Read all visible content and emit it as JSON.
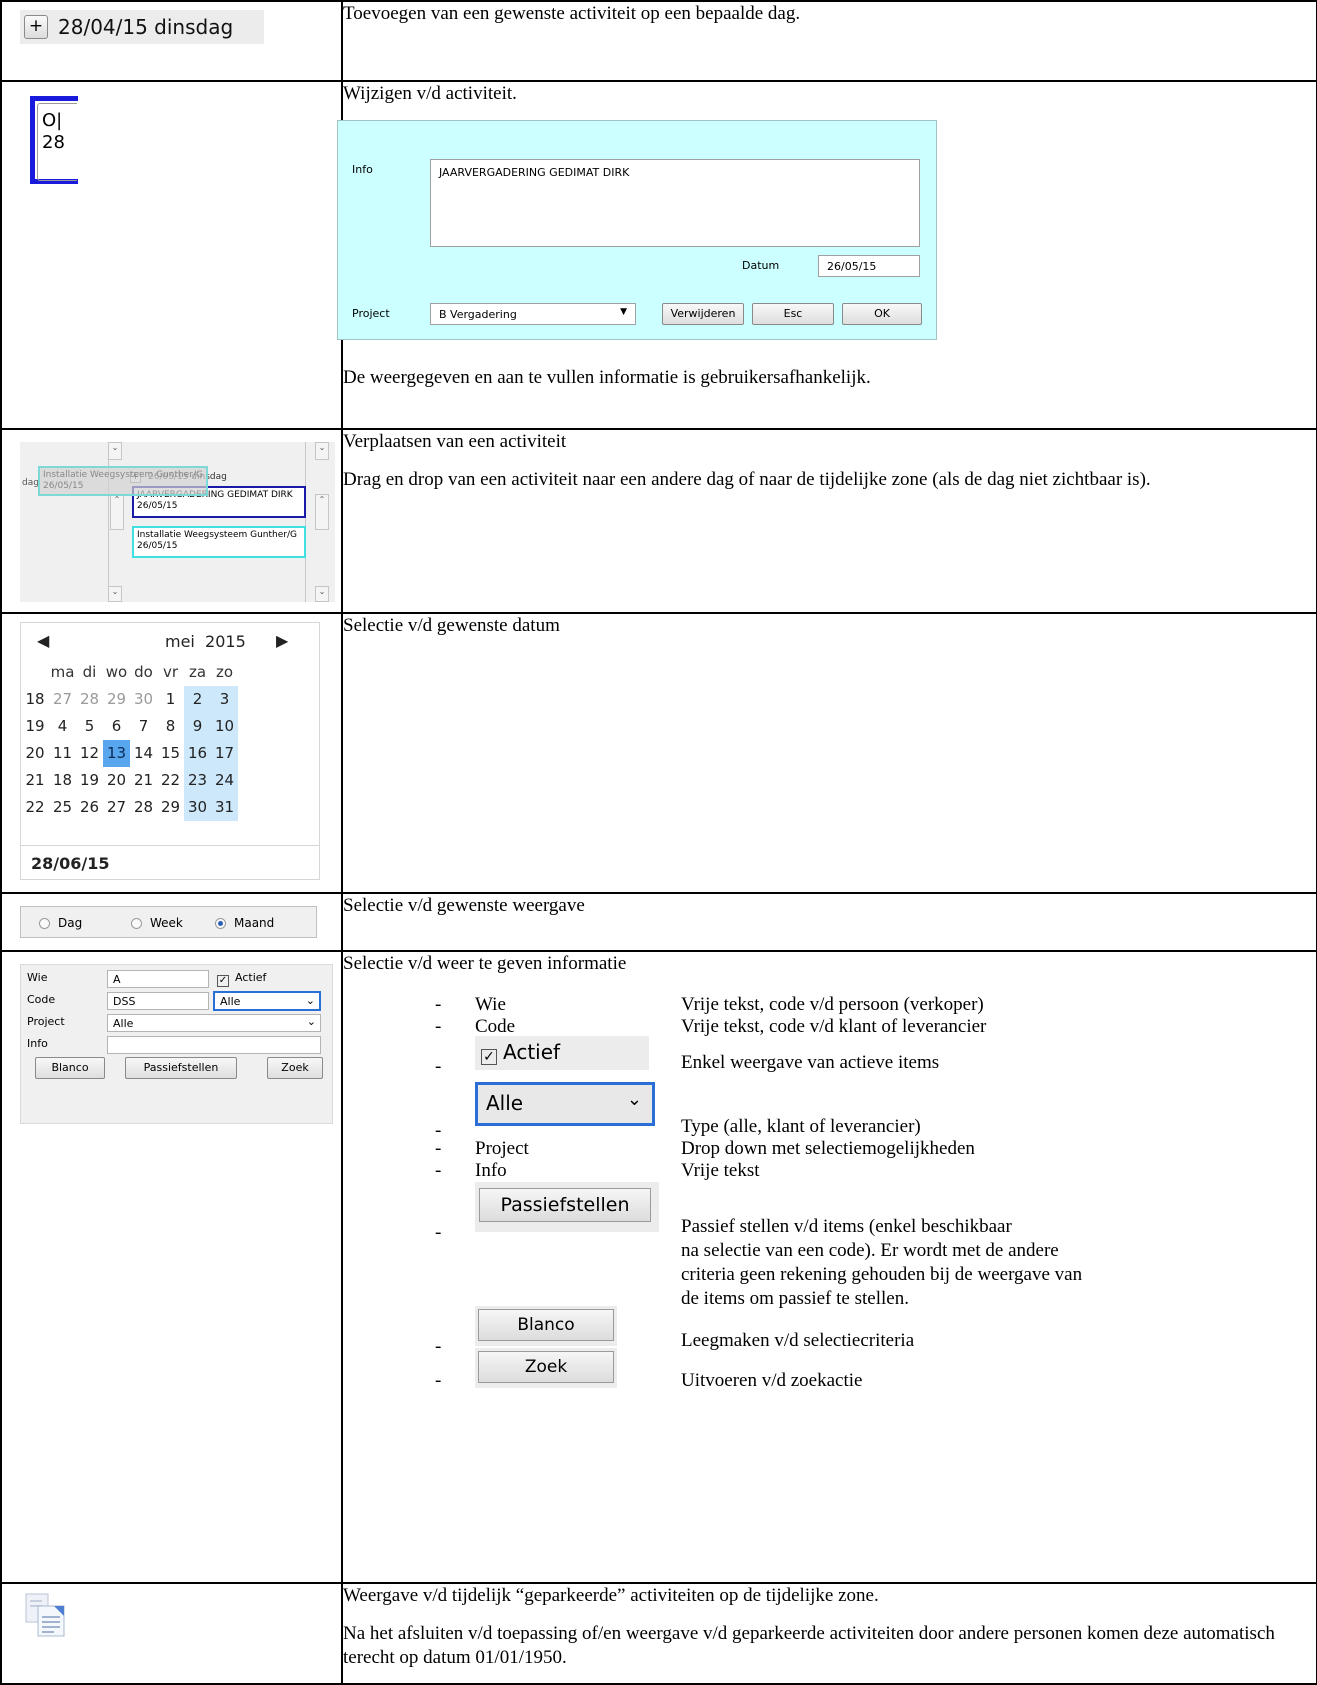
{
  "rows": {
    "add": {
      "date_label": "28/04/15 dinsdag",
      "description": "Toevoegen van een gewenste activiteit op een bepaalde dag."
    },
    "edit": {
      "thumb_line1": "O|",
      "thumb_line2": "28",
      "title": "Wijzigen v/d activiteit.",
      "dialog": {
        "info_label": "Info",
        "info_value": "JAARVERGADERING GEDIMAT DIRK",
        "datum_label": "Datum",
        "datum_value": "26/05/15",
        "project_label": "Project",
        "project_value": "B Vergadering",
        "delete_button": "Verwijderen",
        "esc_button": "Esc",
        "ok_button": "OK"
      },
      "note": "De weergegeven en aan te vullen informatie is gebruikersafhankelijk."
    },
    "move": {
      "screenshot": {
        "day_label": "dag",
        "ghost_line1": "Installatie Weegsysteem Gunther/G",
        "ghost_line2": "26/05/15",
        "header_date": "26/05/15 dinsdag",
        "event1_line1": "JAARVERGADERING GEDIMAT DIRK",
        "event1_line2": "26/05/15",
        "event2_line1": "Installatie Weegsysteem Gunther/G",
        "event2_line2": "26/05/15"
      },
      "title": "Verplaatsen van een activiteit",
      "description": "Drag en drop van een activiteit naar een andere dag of naar de tijdelijke zone (als de dag niet zichtbaar is)."
    },
    "calendar": {
      "month": "mei",
      "year": "2015",
      "weekdays": [
        "ma",
        "di",
        "wo",
        "do",
        "vr",
        "za",
        "zo"
      ],
      "weeks": [
        {
          "wk": "18",
          "days": [
            "27",
            "28",
            "29",
            "30",
            "1",
            "2",
            "3"
          ]
        },
        {
          "wk": "19",
          "days": [
            "4",
            "5",
            "6",
            "7",
            "8",
            "9",
            "10"
          ]
        },
        {
          "wk": "20",
          "days": [
            "11",
            "12",
            "13",
            "14",
            "15",
            "16",
            "17"
          ]
        },
        {
          "wk": "21",
          "days": [
            "18",
            "19",
            "20",
            "21",
            "22",
            "23",
            "24"
          ]
        },
        {
          "wk": "22",
          "days": [
            "25",
            "26",
            "27",
            "28",
            "29",
            "30",
            "31"
          ]
        }
      ],
      "selected_day": "13",
      "footer_date": "28/06/15",
      "description": "Selectie v/d gewenste datum"
    },
    "view": {
      "options": [
        "Dag",
        "Week",
        "Maand"
      ],
      "selected": "Maand",
      "description": "Selectie v/d gewenste weergave"
    },
    "filter": {
      "panel": {
        "wie_label": "Wie",
        "wie_value": "A",
        "actief_label": "Actief",
        "code_label": "Code",
        "code_value": "DSS",
        "type_value": "Alle",
        "project_label": "Project",
        "project_value": "Alle",
        "info_label": "Info",
        "blanco_button": "Blanco",
        "passief_button": "Passiefstellen",
        "zoek_button": "Zoek"
      },
      "title": "Selectie v/d weer te geven informatie",
      "items": {
        "wie_term": "Wie",
        "wie_desc": "Vrije tekst, code v/d persoon (verkoper)",
        "code_term": "Code",
        "code_desc": "Vrije tekst, code v/d klant of leverancier",
        "actief_chip": "Actief",
        "actief_desc": "Enkel weergave van actieve items",
        "alle_chip": "Alle",
        "alle_desc": "Type (alle, klant of leverancier)",
        "project_term": "Project",
        "project_desc": "Drop down met selectiemogelijkheden",
        "info_term": "Info",
        "info_desc": "Vrije tekst",
        "passief_chip": "Passiefstellen",
        "passief_desc_1": "Passief stellen v/d items (enkel beschikbaar",
        "passief_desc_2": "na selectie van een code). Er wordt met de andere",
        "passief_desc_3": "criteria geen rekening gehouden bij de weergave van",
        "passief_desc_4": "de items om passief te stellen.",
        "blanco_chip": "Blanco",
        "blanco_desc": "Leegmaken v/d selectiecriteria",
        "zoek_chip": "Zoek",
        "zoek_desc": "Uitvoeren v/d zoekactie",
        "dash": "-"
      }
    },
    "parked": {
      "title": "Weergave v/d tijdelijk “geparkeerde” activiteiten op de tijdelijke zone.",
      "description": "Na het afsluiten v/d toepassing of/en weergave v/d geparkeerde activiteiten door andere personen komen deze automatisch terecht op datum 01/01/1950."
    }
  }
}
